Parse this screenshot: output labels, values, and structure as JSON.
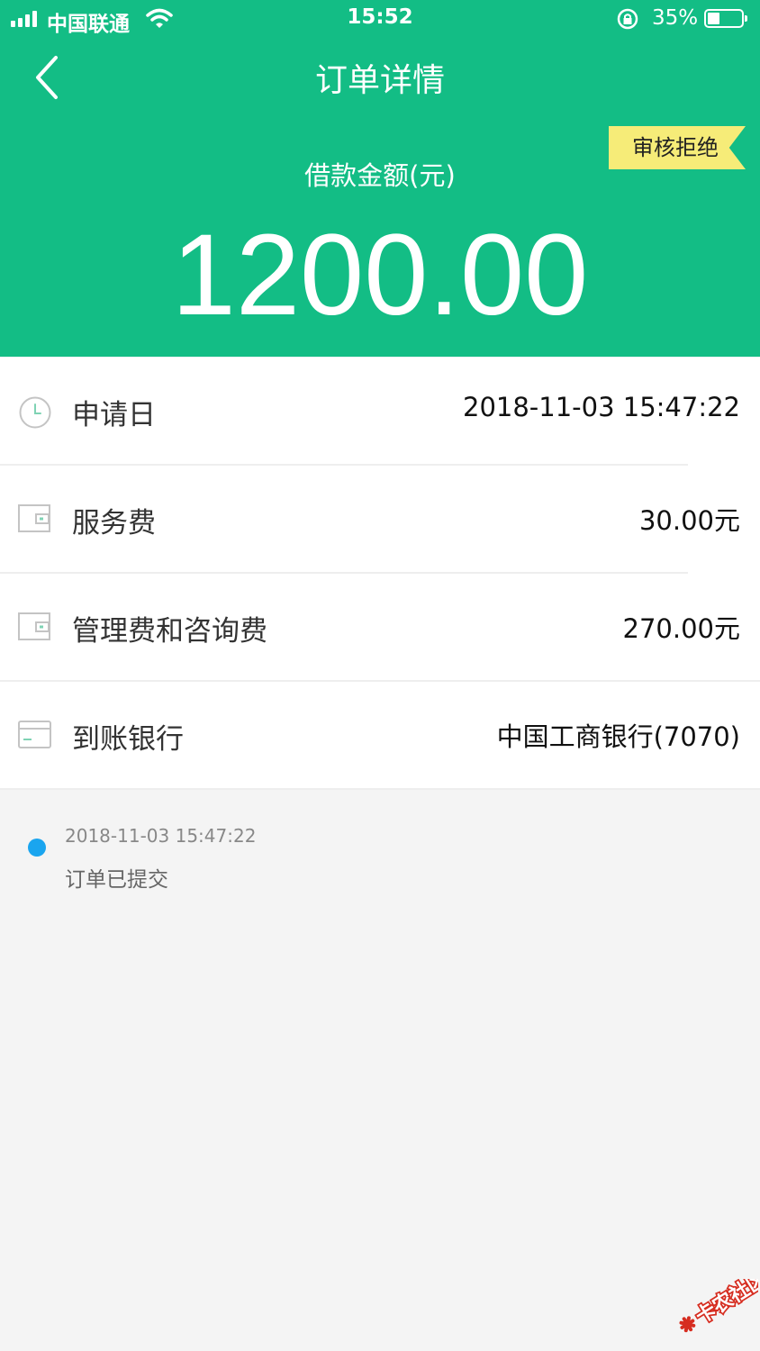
{
  "status_bar": {
    "carrier": "中国联通",
    "time": "15:52",
    "battery": "35%",
    "battery_level": 0.35
  },
  "nav": {
    "title": "订单详情",
    "back_icon": "chevron-left-icon"
  },
  "summary": {
    "status_tag": "审核拒绝",
    "amount_label": "借款金额(元)",
    "amount": "1200.00",
    "colors": {
      "header": "#13bd85",
      "tag": "#f6ec78"
    }
  },
  "details": [
    {
      "icon": "clock-icon",
      "label": "申请日",
      "value": "2018-11-03 15:47:22"
    },
    {
      "icon": "wallet-icon",
      "label": "服务费",
      "value": "30.00元"
    },
    {
      "icon": "wallet-icon",
      "label": "管理费和咨询费",
      "value": "270.00元"
    },
    {
      "icon": "bank-card-icon",
      "label": "到账银行",
      "value": "中国工商银行(7070)"
    }
  ],
  "timeline": [
    {
      "time": "2018-11-03 15:47:22",
      "text": "订单已提交",
      "dot_color": "#1aa5ef"
    }
  ],
  "watermark": {
    "text": "卡农社区"
  }
}
